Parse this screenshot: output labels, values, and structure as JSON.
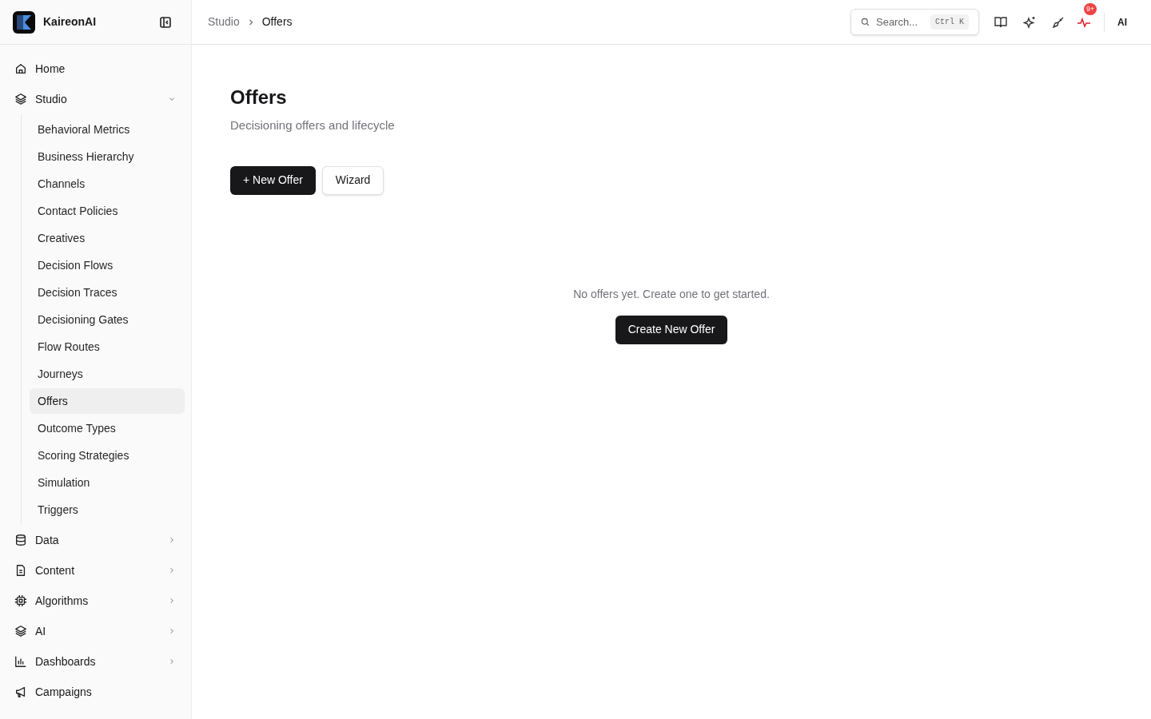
{
  "brand": {
    "name": "KaireonAI"
  },
  "sidebar": {
    "items": [
      {
        "label": "Home",
        "kind": "link"
      },
      {
        "label": "Studio",
        "kind": "group",
        "expanded": true,
        "children": [
          {
            "label": "Behavioral Metrics",
            "selected": false
          },
          {
            "label": "Business Hierarchy",
            "selected": false
          },
          {
            "label": "Channels",
            "selected": false
          },
          {
            "label": "Contact Policies",
            "selected": false
          },
          {
            "label": "Creatives",
            "selected": false
          },
          {
            "label": "Decision Flows",
            "selected": false
          },
          {
            "label": "Decision Traces",
            "selected": false
          },
          {
            "label": "Decisioning Gates",
            "selected": false
          },
          {
            "label": "Flow Routes",
            "selected": false
          },
          {
            "label": "Journeys",
            "selected": false
          },
          {
            "label": "Offers",
            "selected": true
          },
          {
            "label": "Outcome Types",
            "selected": false
          },
          {
            "label": "Scoring Strategies",
            "selected": false
          },
          {
            "label": "Simulation",
            "selected": false
          },
          {
            "label": "Triggers",
            "selected": false
          }
        ]
      },
      {
        "label": "Data",
        "kind": "group",
        "expanded": false
      },
      {
        "label": "Content",
        "kind": "group",
        "expanded": false
      },
      {
        "label": "Algorithms",
        "kind": "group",
        "expanded": false
      },
      {
        "label": "AI",
        "kind": "group",
        "expanded": false
      },
      {
        "label": "Dashboards",
        "kind": "group",
        "expanded": false
      },
      {
        "label": "Campaigns",
        "kind": "link"
      }
    ]
  },
  "breadcrumb": [
    "Studio",
    "Offers"
  ],
  "search": {
    "placeholder": "Search...",
    "shortcut": "Ctrl K"
  },
  "notifications": {
    "badge": "9+"
  },
  "user": {
    "initials": "AI"
  },
  "page": {
    "title": "Offers",
    "subtitle": "Decisioning offers and lifecycle",
    "buttons": [
      {
        "label": "+ New Offer",
        "kind": "primary"
      },
      {
        "label": "Wizard",
        "kind": "secondary"
      }
    ]
  },
  "empty_state": {
    "message": "No offers yet. Create one to get started.",
    "button": "Create New Offer"
  }
}
